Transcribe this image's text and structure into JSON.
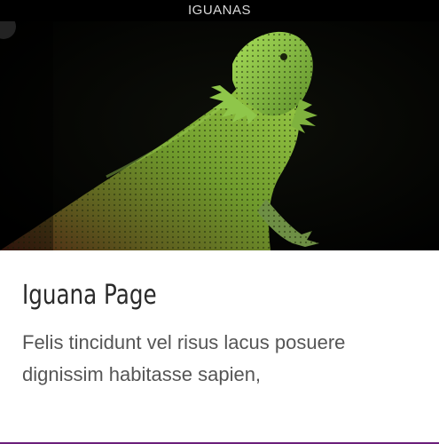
{
  "header": {
    "label": "IGUANAS"
  },
  "hero": {
    "image_icon": "iguana-photo"
  },
  "card": {
    "title": "Iguana Page",
    "description": "Felis tincidunt vel risus lacus posuere dignissim habitasse sapien,"
  },
  "colors": {
    "label_bg": "#000000",
    "label_text": "#d9d9d9",
    "title_text": "#2a2a2a",
    "body_text": "#555555",
    "accent_border": "#6b1f7a"
  }
}
